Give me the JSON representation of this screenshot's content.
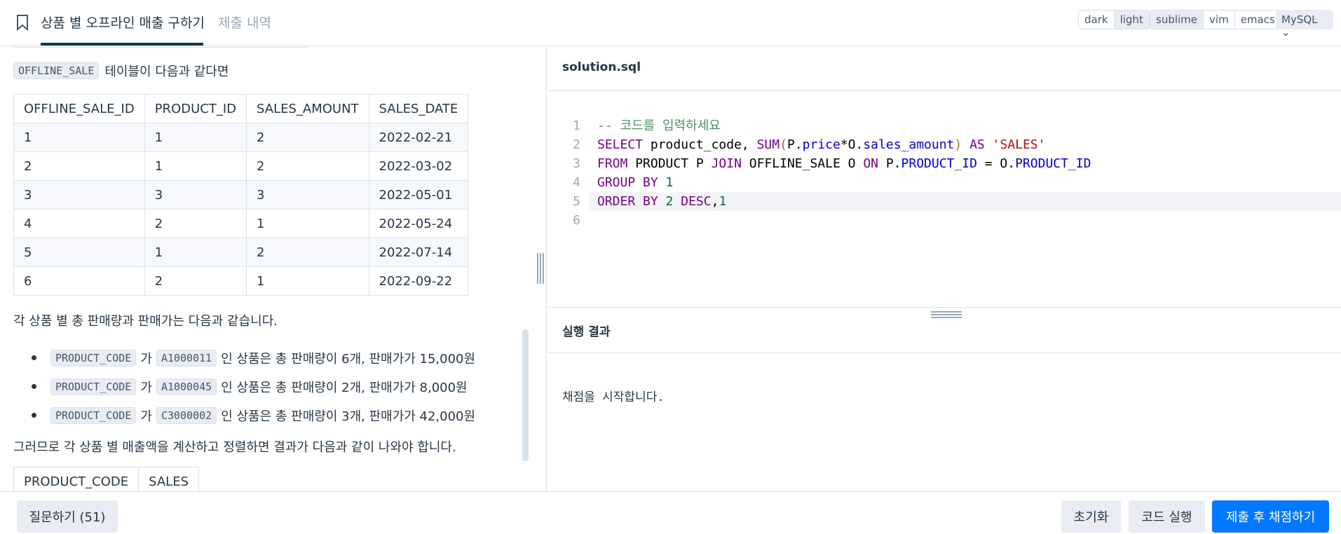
{
  "header": {
    "title": "상품 별 오프라인 매출 구하기",
    "submission_tab": "제출 내역",
    "theme_options": [
      "dark",
      "light"
    ],
    "keymap_options": [
      "sublime",
      "vim",
      "emacs"
    ],
    "language": "MySQL ⌄"
  },
  "problem": {
    "intro_tag": "OFFLINE_SALE",
    "intro_text": "테이블이 다음과 같다면",
    "table1": {
      "headers": [
        "OFFLINE_SALE_ID",
        "PRODUCT_ID",
        "SALES_AMOUNT",
        "SALES_DATE"
      ],
      "rows": [
        [
          "1",
          "1",
          "2",
          "2022-02-21"
        ],
        [
          "2",
          "1",
          "2",
          "2022-03-02"
        ],
        [
          "3",
          "3",
          "3",
          "2022-05-01"
        ],
        [
          "4",
          "2",
          "1",
          "2022-05-24"
        ],
        [
          "5",
          "1",
          "2",
          "2022-07-14"
        ],
        [
          "6",
          "2",
          "1",
          "2022-09-22"
        ]
      ]
    },
    "summary_text": "각 상품 별 총 판매량과 판매가는 다음과 같습니다.",
    "bullets": [
      {
        "tag": "PRODUCT_CODE",
        "particle": "가",
        "code": "A1000011",
        "text": "인 상품은 총 판매량이 6개, 판매가가 15,000원"
      },
      {
        "tag": "PRODUCT_CODE",
        "particle": "가",
        "code": "A1000045",
        "text": "인 상품은 총 판매량이 2개, 판매가가 8,000원"
      },
      {
        "tag": "PRODUCT_CODE",
        "particle": "가",
        "code": "C3000002",
        "text": "인 상품은 총 판매량이 3개, 판매가가 42,000원"
      }
    ],
    "result_text": "그러므로 각 상품 별 매출액을 계산하고 정렬하면 결과가 다음과 같이 나와야 합니다.",
    "table2_headers": [
      "PRODUCT_CODE",
      "SALES"
    ]
  },
  "editor": {
    "filename": "solution.sql",
    "line_numbers": [
      "1",
      "2",
      "3",
      "4",
      "5",
      "6"
    ]
  },
  "result": {
    "title": "실행 결과",
    "output": "채점을 시작합니다."
  },
  "footer": {
    "ask_button": "질문하기 (51)",
    "reset_button": "초기화",
    "run_button": "코드 실행",
    "submit_button": "제출 후 채점하기"
  }
}
